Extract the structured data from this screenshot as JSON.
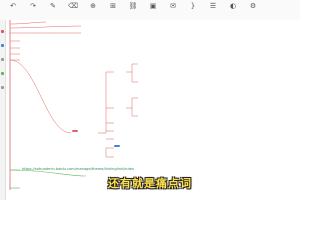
{
  "toolbar": {
    "items": [
      {
        "label": "",
        "icon": "undo-icon",
        "glyph": "↶"
      },
      {
        "label": "",
        "icon": "redo-icon",
        "glyph": "↷"
      },
      {
        "label": "",
        "icon": "format-painter-icon",
        "glyph": "✎"
      },
      {
        "label": "",
        "icon": "clear-format-icon",
        "glyph": "⌫"
      },
      {
        "label": "",
        "icon": "insert-node-icon",
        "glyph": "⊕"
      },
      {
        "label": "",
        "icon": "insert-subnode-icon",
        "glyph": "⊞"
      },
      {
        "label": "",
        "icon": "link-icon",
        "glyph": "⛓"
      },
      {
        "label": "",
        "icon": "image-icon",
        "glyph": "▣"
      },
      {
        "label": "",
        "icon": "note-icon",
        "glyph": "✉"
      },
      {
        "label": "",
        "icon": "summary-icon",
        "glyph": "}"
      },
      {
        "label": "",
        "icon": "outline-icon",
        "glyph": "☰"
      },
      {
        "label": "",
        "icon": "theme-icon",
        "glyph": "◐"
      },
      {
        "label": "",
        "icon": "style-icon",
        "glyph": "⚙"
      }
    ]
  },
  "mindmap": {
    "nodes": [
      {
        "id": "n1",
        "text": "",
        "style": "plain"
      },
      {
        "id": "n2",
        "text": "",
        "style": "blue"
      },
      {
        "id": "n3",
        "text": "",
        "style": "plain"
      },
      {
        "id": "n4",
        "text": "",
        "style": "plain"
      },
      {
        "id": "n5",
        "text": "",
        "style": "plain"
      },
      {
        "id": "n6",
        "text": "",
        "style": "box"
      },
      {
        "id": "n7",
        "text": "",
        "style": "plain"
      },
      {
        "id": "n8",
        "text": "",
        "style": "plain"
      },
      {
        "id": "n9",
        "text": "",
        "style": "plain"
      },
      {
        "id": "n10",
        "text": "",
        "style": "plain"
      },
      {
        "id": "n11",
        "text": "",
        "style": "plain"
      },
      {
        "id": "n12",
        "text": "",
        "style": "plain"
      },
      {
        "id": "n13",
        "text": "",
        "style": "plain"
      },
      {
        "id": "n14",
        "text": "",
        "style": "sel"
      },
      {
        "id": "n15",
        "text": "",
        "style": "plain"
      },
      {
        "id": "n16",
        "text": "",
        "style": "plain"
      },
      {
        "id": "n17",
        "text": "",
        "style": "plain"
      },
      {
        "id": "n18",
        "text": "",
        "style": "plain"
      },
      {
        "id": "n19",
        "text": "",
        "style": "green"
      },
      {
        "id": "n20",
        "text": "https://sohuadmin.baidu.com/manage/theme/linkinglink/index",
        "style": "plain"
      },
      {
        "id": "n21",
        "text": "",
        "style": "green"
      }
    ]
  },
  "subtitle": "还有就是痛点词",
  "page_indicator": "",
  "colors": {
    "link_red": "#e06666",
    "link_green": "#5cb85c",
    "subtitle": "#ffe14a"
  }
}
